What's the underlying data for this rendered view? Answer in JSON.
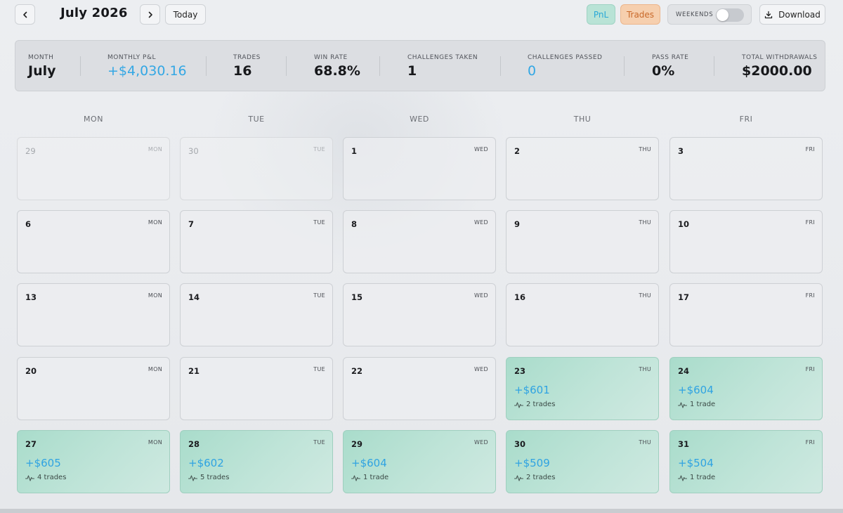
{
  "header": {
    "month_title": "July 2026",
    "today_label": "Today",
    "pnl_label": "PnL",
    "trades_label": "Trades",
    "weekends_label": "WEEKENDS",
    "weekends_on": false,
    "download_label": "Download"
  },
  "stats": [
    {
      "label": "MONTH",
      "value": "July",
      "accent": false
    },
    {
      "label": "MONTHLY P&L",
      "value": "+$4,030.16",
      "accent": true
    },
    {
      "label": "TRADES",
      "value": "16",
      "accent": false
    },
    {
      "label": "WIN RATE",
      "value": "68.8%",
      "accent": false
    },
    {
      "label": "CHALLENGES TAKEN",
      "value": "1",
      "accent": false
    },
    {
      "label": "CHALLENGES PASSED",
      "value": "0",
      "accent": true
    },
    {
      "label": "PASS RATE",
      "value": "0%",
      "accent": false
    },
    {
      "label": "TOTAL WITHDRAWALS",
      "value": "$2000.00",
      "accent": false
    }
  ],
  "weekdays": [
    "MON",
    "TUE",
    "WED",
    "THU",
    "FRI"
  ],
  "weeks": [
    [
      {
        "day": "29",
        "dow": "MON",
        "outside": true
      },
      {
        "day": "30",
        "dow": "TUE",
        "outside": true
      },
      {
        "day": "1",
        "dow": "WED"
      },
      {
        "day": "2",
        "dow": "THU"
      },
      {
        "day": "3",
        "dow": "FRI"
      }
    ],
    [
      {
        "day": "6",
        "dow": "MON"
      },
      {
        "day": "7",
        "dow": "TUE"
      },
      {
        "day": "8",
        "dow": "WED"
      },
      {
        "day": "9",
        "dow": "THU"
      },
      {
        "day": "10",
        "dow": "FRI"
      }
    ],
    [
      {
        "day": "13",
        "dow": "MON"
      },
      {
        "day": "14",
        "dow": "TUE"
      },
      {
        "day": "15",
        "dow": "WED"
      },
      {
        "day": "16",
        "dow": "THU"
      },
      {
        "day": "17",
        "dow": "FRI"
      }
    ],
    [
      {
        "day": "20",
        "dow": "MON"
      },
      {
        "day": "21",
        "dow": "TUE"
      },
      {
        "day": "22",
        "dow": "WED"
      },
      {
        "day": "23",
        "dow": "THU",
        "pnl": "+$601",
        "trades": "2 trades"
      },
      {
        "day": "24",
        "dow": "FRI",
        "pnl": "+$604",
        "trades": "1 trade"
      }
    ],
    [
      {
        "day": "27",
        "dow": "MON",
        "pnl": "+$605",
        "trades": "4 trades"
      },
      {
        "day": "28",
        "dow": "TUE",
        "pnl": "+$602",
        "trades": "5 trades"
      },
      {
        "day": "29",
        "dow": "WED",
        "pnl": "+$604",
        "trades": "1 trade"
      },
      {
        "day": "30",
        "dow": "THU",
        "pnl": "+$509",
        "trades": "2 trades"
      },
      {
        "day": "31",
        "dow": "FRI",
        "pnl": "+$504",
        "trades": "1 trade"
      }
    ]
  ],
  "colors": {
    "accent_blue": "#33a7e4",
    "trade_cell": "#a9dccb",
    "pnl_pill": "#b9e3d6",
    "trades_pill": "#f6cfae"
  }
}
